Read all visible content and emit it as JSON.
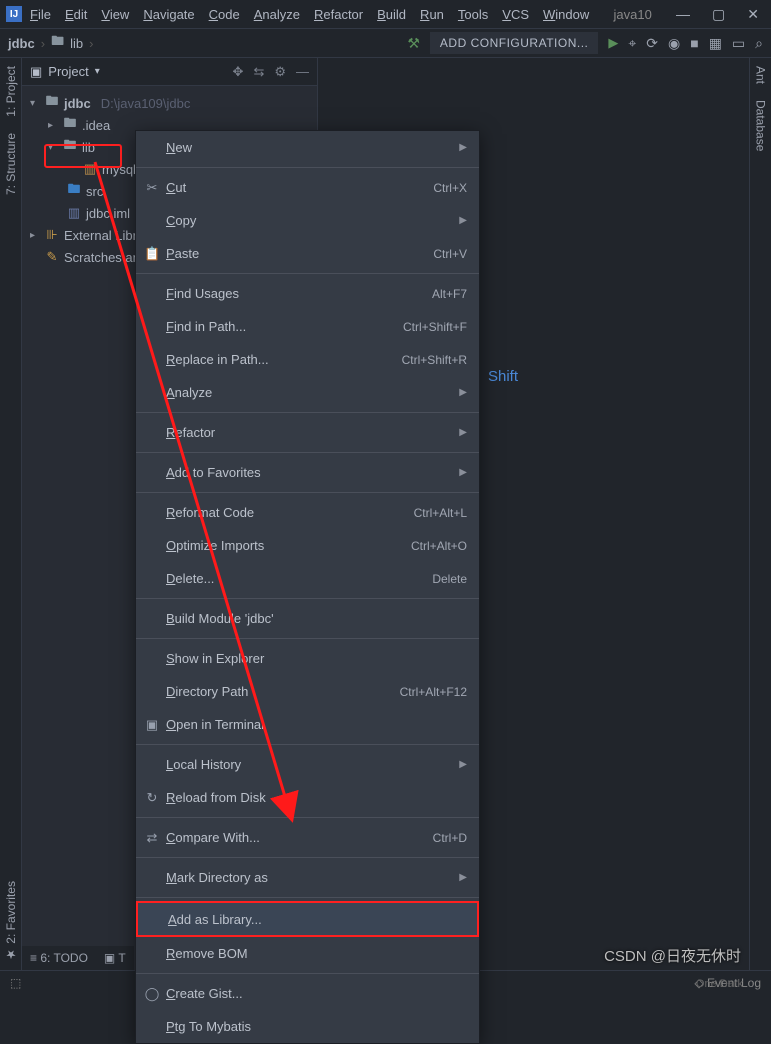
{
  "title_right": "java10",
  "menu": [
    "File",
    "Edit",
    "View",
    "Navigate",
    "Code",
    "Analyze",
    "Refactor",
    "Build",
    "Run",
    "Tools",
    "VCS",
    "Window"
  ],
  "breadcrumb": {
    "root": "jdbc",
    "child": "lib"
  },
  "toolbar": {
    "add_config": "ADD CONFIGURATION..."
  },
  "project_panel": {
    "title": "Project"
  },
  "tree": {
    "root": {
      "name": "jdbc",
      "path": "D:\\java109\\jdbc"
    },
    "idea": ".idea",
    "lib": "lib",
    "mysql": "mysql-c",
    "src": "src",
    "iml": "jdbc.iml",
    "ext": "External Libra",
    "scratch": "Scratches and"
  },
  "side_tabs": {
    "project": "1: Project",
    "structure": "7: Structure",
    "favorites": "2: Favorites",
    "ant": "Ant",
    "database": "Database"
  },
  "shift_text": "Shift",
  "context_menu": [
    {
      "label": "New",
      "sub": true
    },
    {
      "sep": true
    },
    {
      "label": "Cut",
      "shortcut": "Ctrl+X",
      "icon": "✂"
    },
    {
      "label": "Copy",
      "sub": true
    },
    {
      "label": "Paste",
      "shortcut": "Ctrl+V",
      "icon": "📋"
    },
    {
      "sep": true
    },
    {
      "label": "Find Usages",
      "shortcut": "Alt+F7"
    },
    {
      "label": "Find in Path...",
      "shortcut": "Ctrl+Shift+F"
    },
    {
      "label": "Replace in Path...",
      "shortcut": "Ctrl+Shift+R"
    },
    {
      "label": "Analyze",
      "sub": true
    },
    {
      "sep": true
    },
    {
      "label": "Refactor",
      "sub": true
    },
    {
      "sep": true
    },
    {
      "label": "Add to Favorites",
      "sub": true
    },
    {
      "sep": true
    },
    {
      "label": "Reformat Code",
      "shortcut": "Ctrl+Alt+L"
    },
    {
      "label": "Optimize Imports",
      "shortcut": "Ctrl+Alt+O"
    },
    {
      "label": "Delete...",
      "shortcut": "Delete"
    },
    {
      "sep": true
    },
    {
      "label": "Build Module 'jdbc'"
    },
    {
      "sep": true
    },
    {
      "label": "Show in Explorer"
    },
    {
      "label": "Directory Path",
      "shortcut": "Ctrl+Alt+F12"
    },
    {
      "label": "Open in Terminal",
      "icon": "▣"
    },
    {
      "sep": true
    },
    {
      "label": "Local History",
      "sub": true
    },
    {
      "label": "Reload from Disk",
      "icon": "↻"
    },
    {
      "sep": true
    },
    {
      "label": "Compare With...",
      "shortcut": "Ctrl+D",
      "icon": "⇄"
    },
    {
      "sep": true
    },
    {
      "label": "Mark Directory as",
      "sub": true
    },
    {
      "sep": true
    },
    {
      "label": "Add as Library...",
      "highlight": true
    },
    {
      "label": "Remove BOM"
    },
    {
      "sep": true
    },
    {
      "label": "Create Gist...",
      "icon": "◯"
    },
    {
      "label": "Ptg To Mybatis"
    }
  ],
  "bottom_tabs": {
    "todo": "6: TODO",
    "terminal": "T"
  },
  "statusbar": {
    "event": "Event Log",
    "theme": "One Dark"
  },
  "watermark": "CSDN @日夜无休时"
}
